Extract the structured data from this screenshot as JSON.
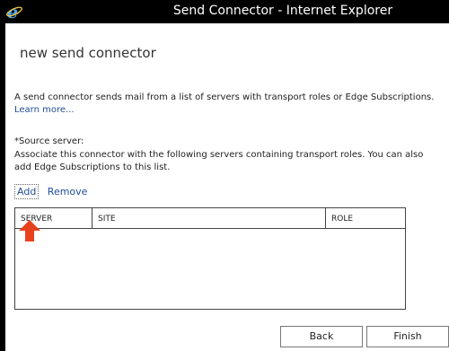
{
  "window": {
    "title": "Send Connector - Internet Explorer",
    "icon": "ie-icon"
  },
  "page": {
    "heading": "new send connector",
    "description": "A send connector sends mail from a list of servers with transport roles or Edge Subscriptions.",
    "learn_more": "Learn more...",
    "source_server_label": "*Source server:",
    "source_server_description": "Associate this connector with the following servers containing transport roles. You can also add Edge Subscriptions to this list."
  },
  "toolbar": {
    "add_label": "Add",
    "remove_label": "Remove"
  },
  "grid": {
    "columns": [
      "SERVER",
      "SITE",
      "ROLE"
    ],
    "rows": []
  },
  "footer": {
    "back_label": "Back",
    "finish_label": "Finish"
  },
  "colors": {
    "titlebar": "#000000",
    "link": "#1f4e99",
    "annotation_arrow": "#e8421c"
  }
}
